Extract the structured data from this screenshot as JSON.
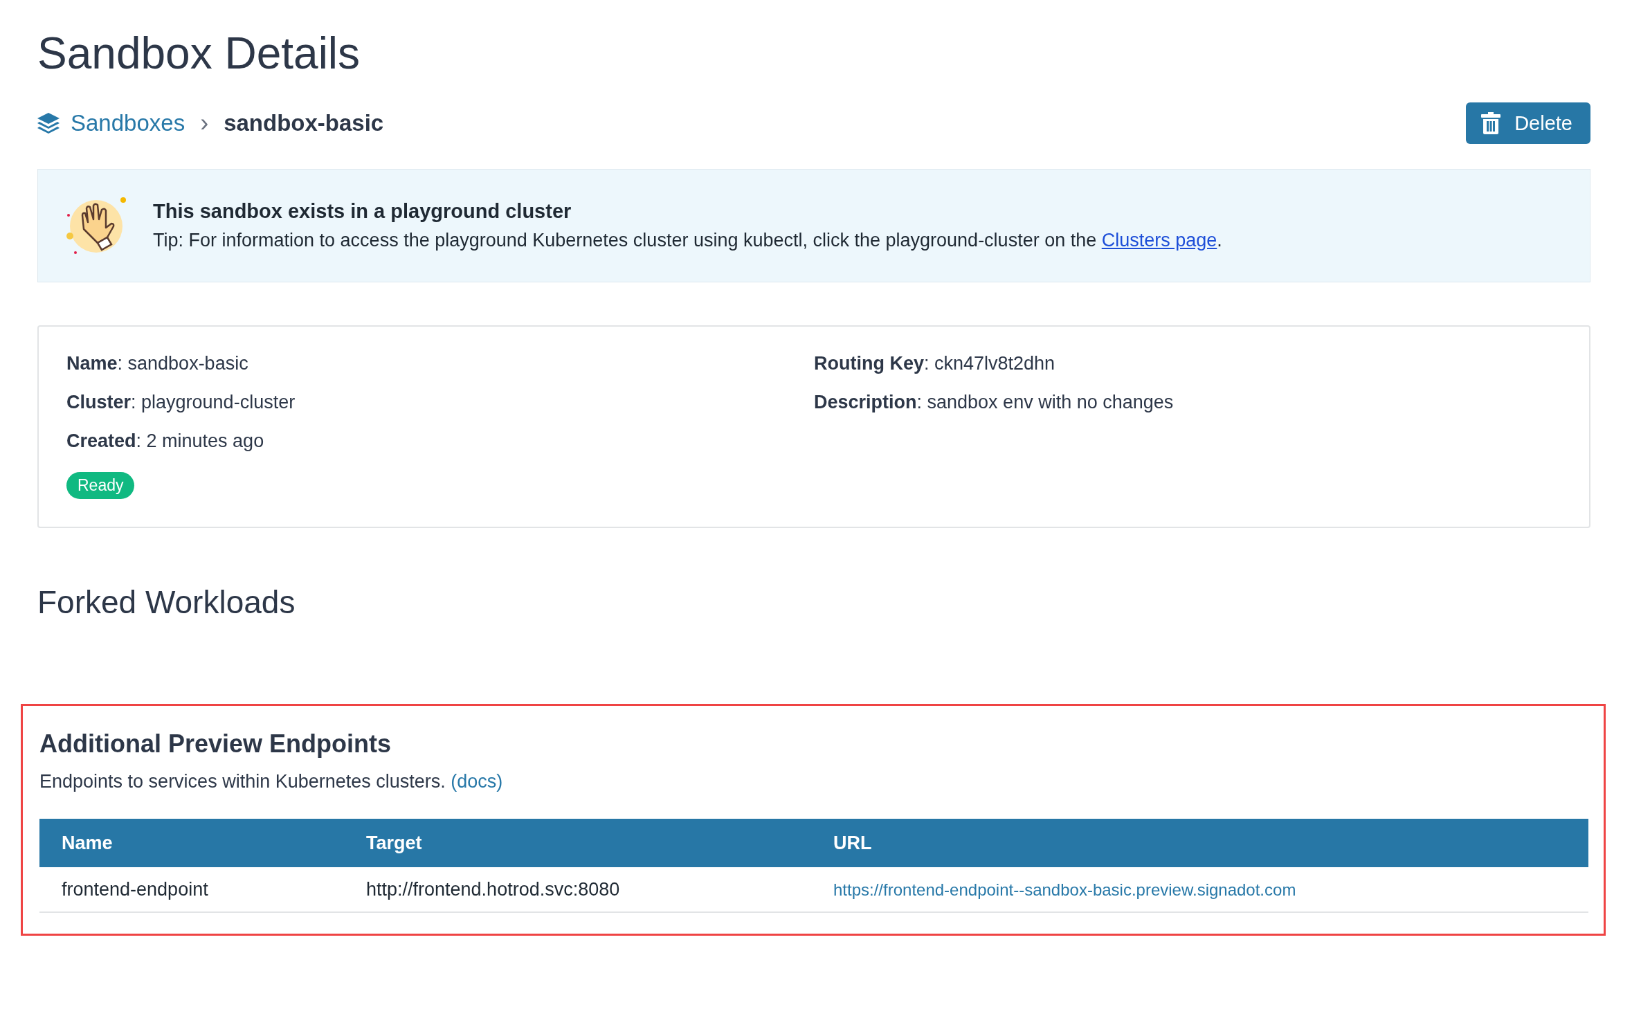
{
  "page_title": "Sandbox Details",
  "breadcrumb": {
    "parent": "Sandboxes",
    "separator": "›",
    "current": "sandbox-basic"
  },
  "delete_button": {
    "label": "Delete"
  },
  "banner": {
    "title": "This sandbox exists in a playground cluster",
    "text_before": "Tip: For information to access the playground Kubernetes cluster using kubectl, click the playground-cluster on the ",
    "link": "Clusters page",
    "text_after": "."
  },
  "details": {
    "left": [
      {
        "text": "**Name**: sandbox-basic"
      },
      {
        "text": "**Cluster**: playground-cluster"
      },
      {
        "text": "**Created**: 2 minutes ago"
      }
    ],
    "right": [
      {
        "text": "**Routing Key**: ckn47lv8t2dhn"
      },
      {
        "text": "**Description**: sandbox env with no changes"
      }
    ],
    "status": {
      "label": "Ready",
      "color": "#10b981"
    }
  },
  "forked_workloads": {
    "title": "Forked Workloads"
  },
  "endpoints": {
    "highlighted": true,
    "title": "Additional Preview Endpoints",
    "description": "Endpoints to services within Kubernetes clusters.",
    "docs_link": "(docs)",
    "table": {
      "columns": [
        "Name",
        "Target",
        "URL"
      ],
      "rows": [
        {
          "name": "frontend-endpoint",
          "target": "http://frontend.hotrod.svc:8080",
          "url": "https://frontend-endpoint--sandbox-basic.preview.signadot.com"
        }
      ]
    }
  }
}
